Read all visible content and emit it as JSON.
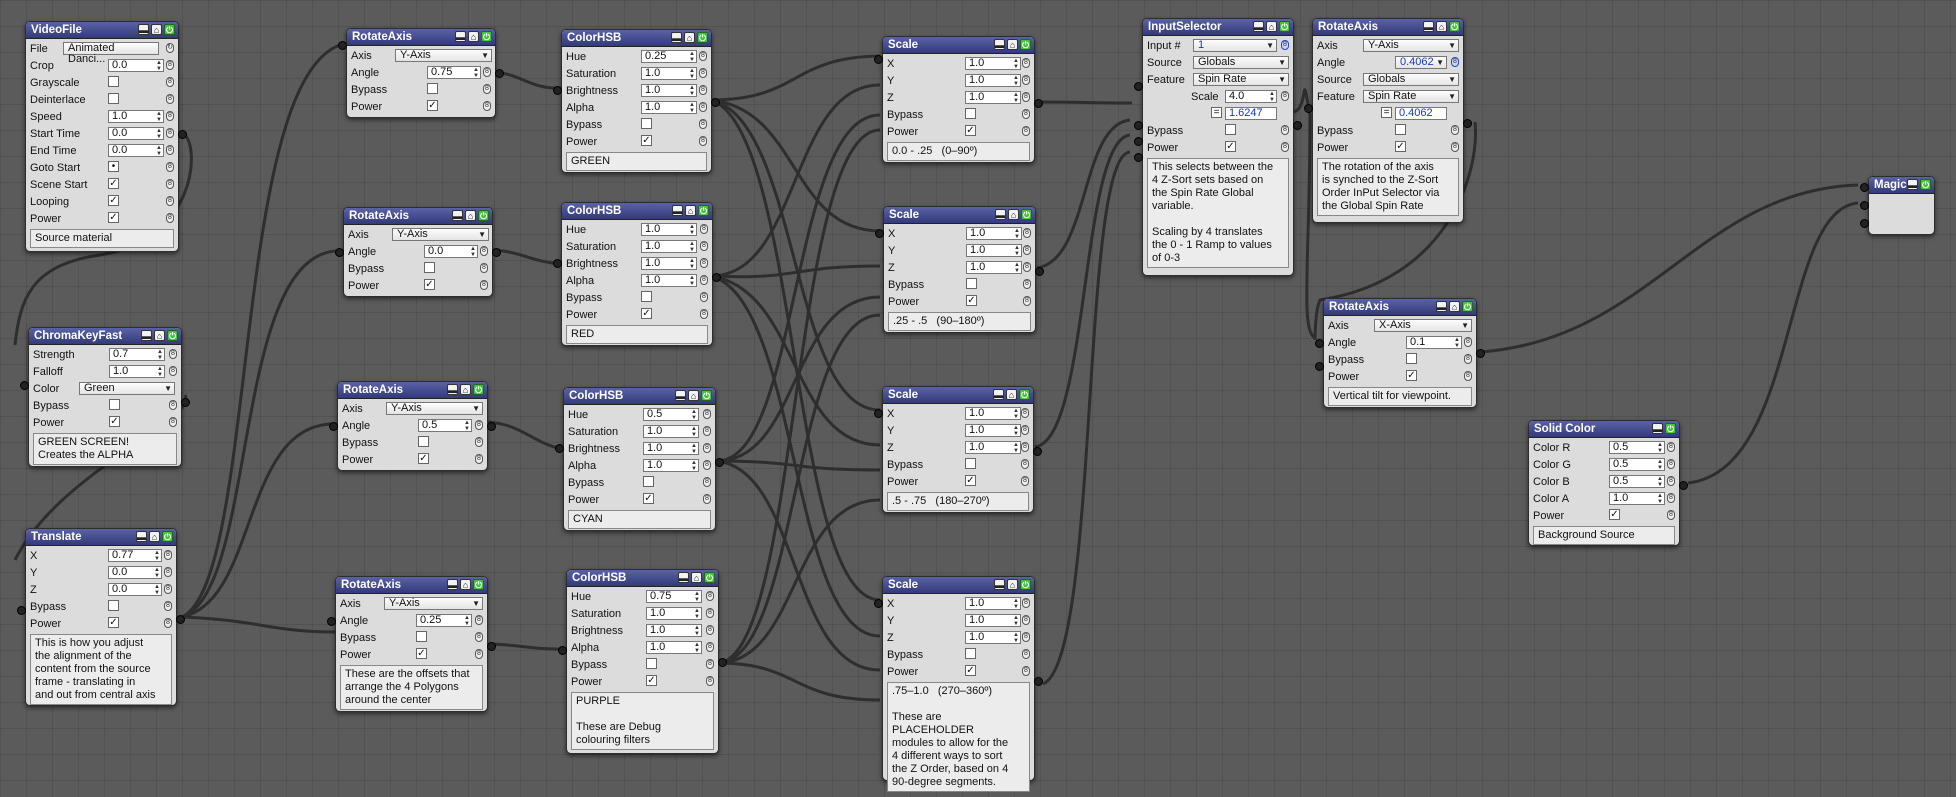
{
  "nodes": {
    "videofile": {
      "title": "VideoFile",
      "file_label": "File",
      "file_value": "Animated Danci...",
      "rows": [
        {
          "label": "Crop",
          "value": "0.0"
        },
        {
          "label": "Grayscale",
          "check": ""
        },
        {
          "label": "Deinterlace",
          "check": ""
        },
        {
          "label": "Speed",
          "value": "1.0"
        },
        {
          "label": "Start Time",
          "value": "0.0"
        },
        {
          "label": "End Time",
          "value": "0.0"
        },
        {
          "label": "Goto Start",
          "check": "•"
        },
        {
          "label": "Scene Start",
          "check": "✓"
        },
        {
          "label": "Looping",
          "check": "✓"
        },
        {
          "label": "Power",
          "check": "✓"
        }
      ],
      "note": "Source material"
    },
    "chromakey": {
      "title": "ChromaKeyFast",
      "strength_label": "Strength",
      "strength": "0.7",
      "falloff_label": "Falloff",
      "falloff": "1.0",
      "color_label": "Color",
      "color": "Green",
      "bypass_label": "Bypass",
      "power_label": "Power",
      "check_on": "✓",
      "note": "GREEN SCREEN!\nCreates the ALPHA"
    },
    "translate": {
      "title": "Translate",
      "x_label": "X",
      "x": "0.77",
      "y_label": "Y",
      "y": "0.0",
      "z_label": "Z",
      "z": "0.0",
      "bypass_label": "Bypass",
      "power_label": "Power",
      "check_on": "✓",
      "note": "This is how you adjust\nthe alignment of the\ncontent from the source\nframe - translating in\nand out from central axis"
    },
    "rotate1": {
      "title": "RotateAxis",
      "axis_label": "Axis",
      "axis": "Y-Axis",
      "angle_label": "Angle",
      "angle": "0.75",
      "bypass_label": "Bypass",
      "power_label": "Power",
      "check_on": "✓"
    },
    "rotate2": {
      "title": "RotateAxis",
      "axis_label": "Axis",
      "axis": "Y-Axis",
      "angle_label": "Angle",
      "angle": "0.0",
      "bypass_label": "Bypass",
      "power_label": "Power",
      "check_on": "✓"
    },
    "rotate3": {
      "title": "RotateAxis",
      "axis_label": "Axis",
      "axis": "Y-Axis",
      "angle_label": "Angle",
      "angle": "0.5",
      "bypass_label": "Bypass",
      "power_label": "Power",
      "check_on": "✓"
    },
    "rotate4": {
      "title": "RotateAxis",
      "axis_label": "Axis",
      "axis": "Y-Axis",
      "angle_label": "Angle",
      "angle": "0.25",
      "bypass_label": "Bypass",
      "power_label": "Power",
      "check_on": "✓",
      "note": "These are the offsets that\narrange the 4 Polygons\naround the center"
    },
    "hsb1": {
      "title": "ColorHSB",
      "hue_label": "Hue",
      "hue": "0.25",
      "sat_label": "Saturation",
      "sat": "1.0",
      "bri_label": "Brightness",
      "bri": "1.0",
      "alpha_label": "Alpha",
      "alpha": "1.0",
      "bypass_label": "Bypass",
      "power_label": "Power",
      "check_on": "✓",
      "note": "GREEN"
    },
    "hsb2": {
      "title": "ColorHSB",
      "hue_label": "Hue",
      "hue": "1.0",
      "sat_label": "Saturation",
      "sat": "1.0",
      "bri_label": "Brightness",
      "bri": "1.0",
      "alpha_label": "Alpha",
      "alpha": "1.0",
      "bypass_label": "Bypass",
      "power_label": "Power",
      "check_on": "✓",
      "note": "RED"
    },
    "hsb3": {
      "title": "ColorHSB",
      "hue_label": "Hue",
      "hue": "0.5",
      "sat_label": "Saturation",
      "sat": "1.0",
      "bri_label": "Brightness",
      "bri": "1.0",
      "alpha_label": "Alpha",
      "alpha": "1.0",
      "bypass_label": "Bypass",
      "power_label": "Power",
      "check_on": "✓",
      "note": "CYAN"
    },
    "hsb4": {
      "title": "ColorHSB",
      "hue_label": "Hue",
      "hue": "0.75",
      "sat_label": "Saturation",
      "sat": "1.0",
      "bri_label": "Brightness",
      "bri": "1.0",
      "alpha_label": "Alpha",
      "alpha": "1.0",
      "bypass_label": "Bypass",
      "power_label": "Power",
      "check_on": "✓",
      "note": "PURPLE\n\nThese are Debug\ncolouring filters"
    },
    "scale1": {
      "title": "Scale",
      "x_label": "X",
      "x": "1.0",
      "y_label": "Y",
      "y": "1.0",
      "z_label": "Z",
      "z": "1.0",
      "bypass_label": "Bypass",
      "power_label": "Power",
      "check_on": "✓",
      "note": "0.0 - .25   (0–90º)"
    },
    "scale2": {
      "title": "Scale",
      "x_label": "X",
      "x": "1.0",
      "y_label": "Y",
      "y": "1.0",
      "z_label": "Z",
      "z": "1.0",
      "bypass_label": "Bypass",
      "power_label": "Power",
      "check_on": "✓",
      "note": ".25 - .5   (90–180º)"
    },
    "scale3": {
      "title": "Scale",
      "x_label": "X",
      "x": "1.0",
      "y_label": "Y",
      "y": "1.0",
      "z_label": "Z",
      "z": "1.0",
      "bypass_label": "Bypass",
      "power_label": "Power",
      "check_on": "✓",
      "note": ".5 - .75   (180–270º)"
    },
    "scale4": {
      "title": "Scale",
      "x_label": "X",
      "x": "1.0",
      "y_label": "Y",
      "y": "1.0",
      "z_label": "Z",
      "z": "1.0",
      "bypass_label": "Bypass",
      "power_label": "Power",
      "check_on": "✓",
      "note": ".75–1.0   (270–360º)\n\nThese are PLACEHOLDER\nmodules to allow for the\n4 different ways to sort\nthe Z Order, based on 4\n90-degree segments."
    },
    "inputselector": {
      "title": "InputSelector",
      "input_label": "Input #",
      "input": "1",
      "source_label": "Source",
      "source": "Globals",
      "feature_label": "Feature",
      "feature": "Spin Rate",
      "scale_label": "Scale",
      "scale": "4.0",
      "eq_sign": "=",
      "result": "1.6247",
      "bypass_label": "Bypass",
      "power_label": "Power",
      "check_on": "✓",
      "note": "This selects between the\n4 Z-Sort sets based on\nthe Spin Rate Global\nvariable.\n\nScaling by 4 translates\nthe 0 - 1 Ramp to values\nof 0-3"
    },
    "rotate5": {
      "title": "RotateAxis",
      "axis_label": "Axis",
      "axis": "Y-Axis",
      "angle_label": "Angle",
      "angle": "0.4062",
      "source_label": "Source",
      "source": "Globals",
      "feature_label": "Feature",
      "feature": "Spin Rate",
      "eq_sign": "=",
      "result": "0.4062",
      "bypass_label": "Bypass",
      "power_label": "Power",
      "check_on": "✓",
      "note": "The rotation of the axis\nis synched to the Z-Sort\nOrder InPut Selector via\nthe Global Spin Rate"
    },
    "rotate6": {
      "title": "RotateAxis",
      "axis_label": "Axis",
      "axis": "X-Axis",
      "angle_label": "Angle",
      "angle": "0.1",
      "bypass_label": "Bypass",
      "power_label": "Power",
      "check_on": "✓",
      "note": "Vertical tilt for viewpoint."
    },
    "solidcolor": {
      "title": "Solid Color",
      "r_label": "Color R",
      "r": "0.5",
      "g_label": "Color G",
      "g": "0.5",
      "b_label": "Color B",
      "b": "0.5",
      "a_label": "Color A",
      "a": "1.0",
      "power_label": "Power",
      "check_on": "✓",
      "note": "Background Source"
    },
    "magic": {
      "title": "Magic"
    }
  }
}
